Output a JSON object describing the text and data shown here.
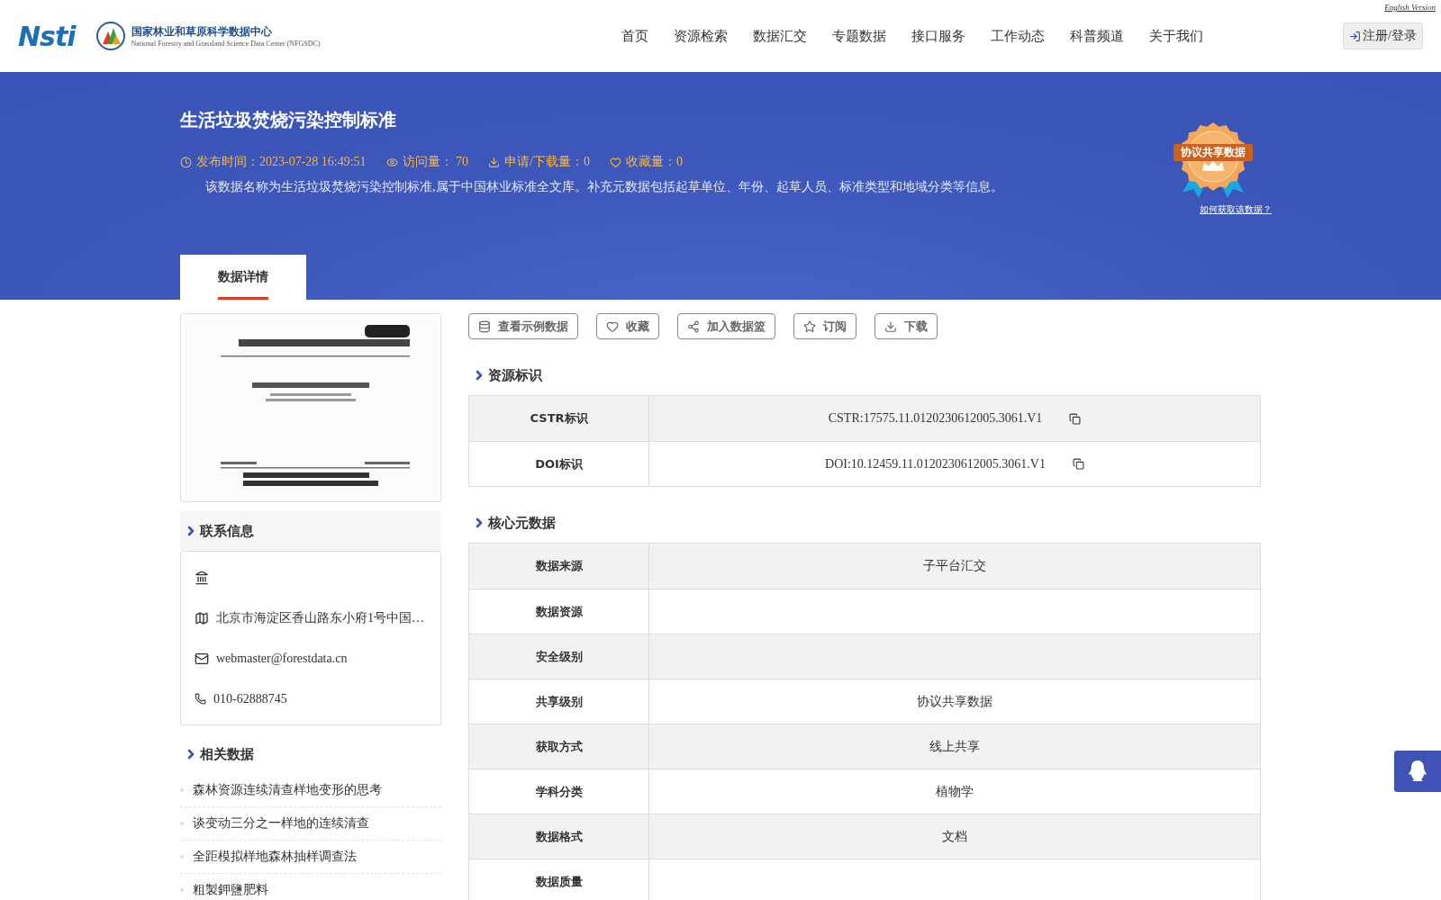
{
  "header": {
    "logo_text": "Nsti",
    "center_name": "国家林业和草原科学数据中心",
    "center_name_en": "National Forestry and Grassland Science Data Center (NFGSDC)",
    "english_link": "English Version",
    "nav": [
      {
        "label": "首页"
      },
      {
        "label": "资源检索"
      },
      {
        "label": "数据汇交"
      },
      {
        "label": "专题数据"
      },
      {
        "label": "接口服务"
      },
      {
        "label": "工作动态"
      },
      {
        "label": "科普频道"
      },
      {
        "label": "关于我们"
      }
    ],
    "login": "注册/登录"
  },
  "banner": {
    "title": "生活垃圾焚烧污染控制标准",
    "meta": [
      {
        "kind": "clock",
        "text": "发布时间：2023-07-28 16:49:51"
      },
      {
        "kind": "eye",
        "text": "访问量： 70"
      },
      {
        "kind": "download",
        "text": "申请/下载量：0"
      },
      {
        "kind": "heart",
        "text": "收藏量：0"
      }
    ],
    "description": "该数据名称为生活垃圾焚烧污染控制标准,属于中国林业标准全文库。补充元数据包括起草单位、年份、起草人员、标准类型和地域分类等信息。",
    "badge": "协议共享数据",
    "badge_link": "如何获取该数据？"
  },
  "tabs": [
    {
      "label": "数据详情",
      "selected": true
    }
  ],
  "contact": {
    "title": "联系信息",
    "items": [
      {
        "kind": "institution"
      },
      {
        "kind": "address",
        "text": "北京市海淀区香山路东小府1号中国…"
      },
      {
        "kind": "email",
        "text": "webmaster@forestdata.cn"
      },
      {
        "kind": "phone",
        "text": "010-62888745"
      }
    ]
  },
  "related": {
    "title": "相关数据",
    "items": [
      "森林资源连续清查样地变形的思考",
      "谈变动三分之一样地的连续清查",
      "全距模拟样地森林抽样调查法",
      "粗製鉀鹽肥料"
    ]
  },
  "actions": [
    {
      "kind": "database",
      "label": "查看示例数据"
    },
    {
      "kind": "heart",
      "label": "收藏"
    },
    {
      "kind": "share",
      "label": "加入数据篮"
    },
    {
      "kind": "star",
      "label": "订阅"
    },
    {
      "kind": "download",
      "label": "下载"
    }
  ],
  "identifiers": {
    "title": "资源标识",
    "rows": [
      {
        "label": "CSTR标识",
        "value": "CSTR:17575.11.0120230612005.3061.V1"
      },
      {
        "label": "DOI标识",
        "value": "DOI:10.12459.11.0120230612005.3061.V1"
      }
    ]
  },
  "core_metadata": {
    "title": "核心元数据",
    "rows": [
      {
        "label": "数据来源",
        "value": "子平台汇交"
      },
      {
        "label": "数据资源"
      },
      {
        "label": "安全级别"
      },
      {
        "label": "共享级别",
        "value": "协议共享数据"
      },
      {
        "label": "获取方式",
        "value": "线上共享"
      },
      {
        "label": "学科分类",
        "value": "植物学"
      },
      {
        "label": "数据格式",
        "value": "文档"
      },
      {
        "label": "数据质量"
      }
    ]
  }
}
